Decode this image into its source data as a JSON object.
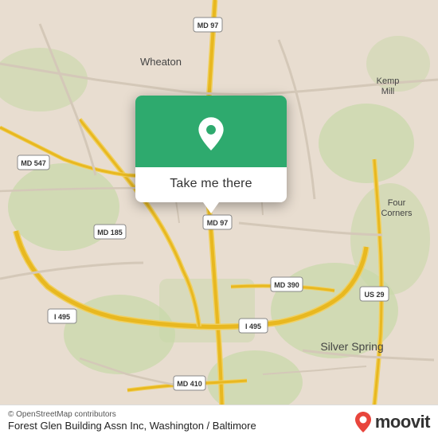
{
  "map": {
    "background_color": "#e8ddd0",
    "alt": "Map of Washington/Baltimore area showing Forest Glen area"
  },
  "popup": {
    "button_label": "Take me there",
    "green_color": "#2eaa6e",
    "pin_icon": "location-pin"
  },
  "bottom_bar": {
    "copyright": "© OpenStreetMap contributors",
    "place_name": "Forest Glen Building Assn Inc, Washington /",
    "place_subtitle": "Baltimore",
    "moovit_label": "moovit"
  },
  "map_labels": {
    "wheaton": "Wheaton",
    "kemp_mill": "Kemp\nMill",
    "four_corners": "Four\nCorners",
    "silver_spring": "Silver Spring",
    "md97_north": "MD 97",
    "md97_south": "MD 97",
    "md547": "MD 547",
    "md185": "MD 185",
    "md390": "MD 390",
    "md410": "MD 410",
    "i495_west": "I 495",
    "i495_east": "I 495",
    "us29": "US 29"
  }
}
